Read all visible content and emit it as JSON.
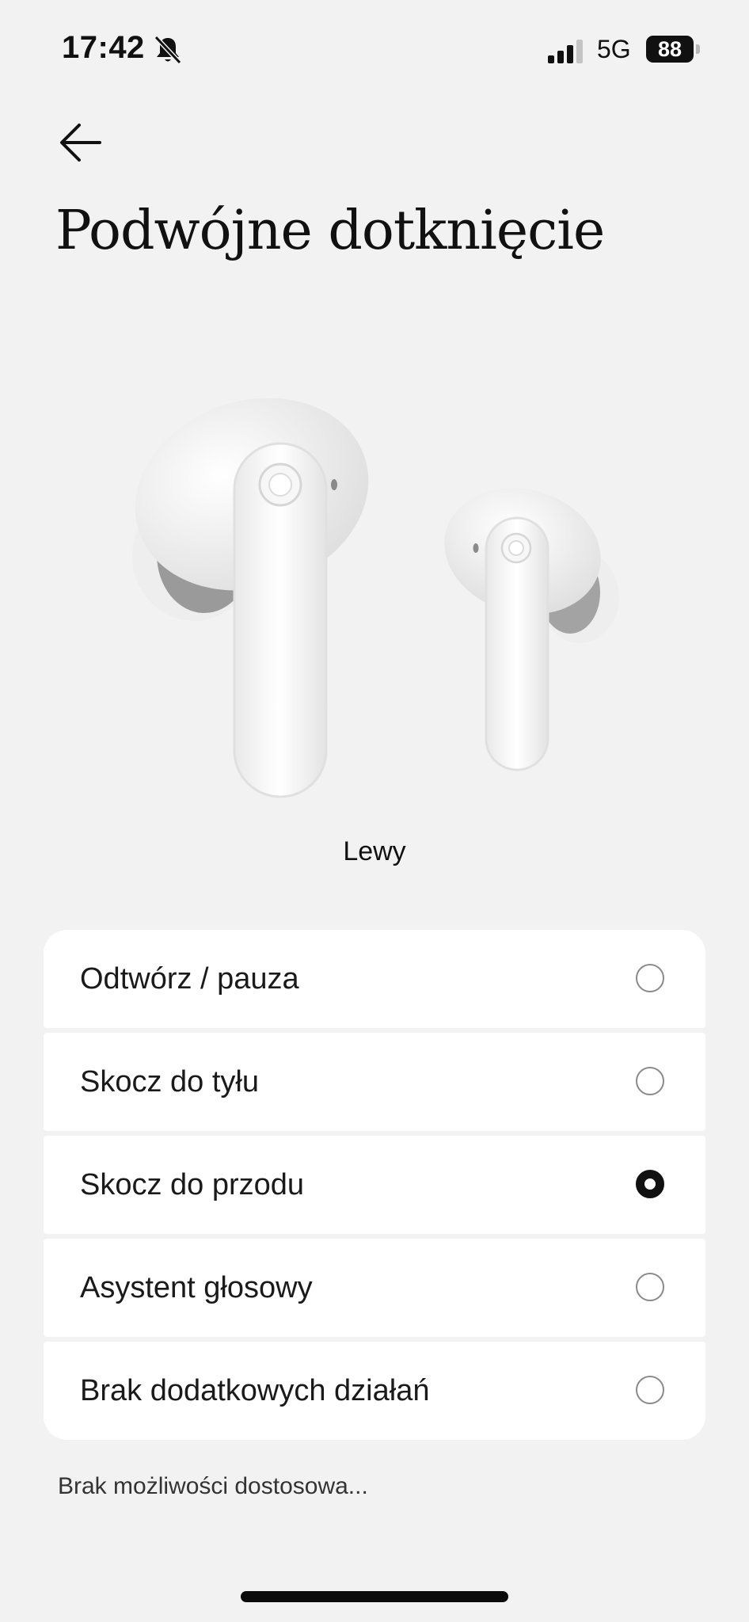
{
  "status_bar": {
    "time": "17:42",
    "network": "5G",
    "battery": "88",
    "icons": [
      "bell-off-icon",
      "signal-icon",
      "battery-icon"
    ]
  },
  "header": {
    "back_icon": "arrow-left-icon",
    "title": "Podwójne dotknięcie"
  },
  "device": {
    "image": "earbuds-image",
    "side_label": "Lewy"
  },
  "options": [
    {
      "label": "Odtwórz / pauza",
      "selected": false
    },
    {
      "label": "Skocz do tyłu",
      "selected": false
    },
    {
      "label": "Skocz do przodu",
      "selected": true
    },
    {
      "label": "Asystent głosowy",
      "selected": false
    },
    {
      "label": "Brak dodatkowych działań",
      "selected": false
    }
  ],
  "footnote": "Brak możliwości dostosowa...",
  "colors": {
    "background": "#f2f2f2",
    "card": "#ffffff",
    "text": "#111111",
    "radio_border": "#8a8a8a"
  }
}
